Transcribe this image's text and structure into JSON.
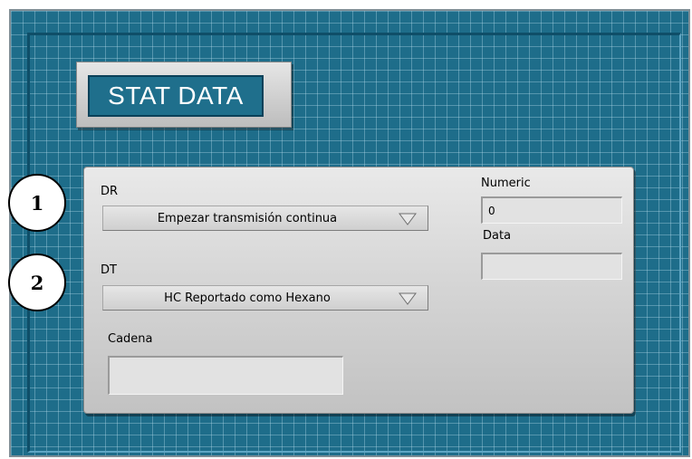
{
  "front_panel": {
    "title": "STAT DATA",
    "dr": {
      "label": "DR",
      "value": "Empezar transmisión continua"
    },
    "dt": {
      "label": "DT",
      "value": "HC Reportado como Hexano"
    },
    "cadena": {
      "label": "Cadena",
      "value": ""
    },
    "numeric": {
      "label": "Numeric",
      "value": "0"
    },
    "data": {
      "label": "Data",
      "value": ""
    }
  },
  "callouts": [
    "1",
    "2"
  ],
  "colors": {
    "panel_background": "#1e6d8a",
    "grid_line": "#7fb6cc",
    "title_plate": "#1f6f8c",
    "control_panel": "#d6d6d6"
  }
}
